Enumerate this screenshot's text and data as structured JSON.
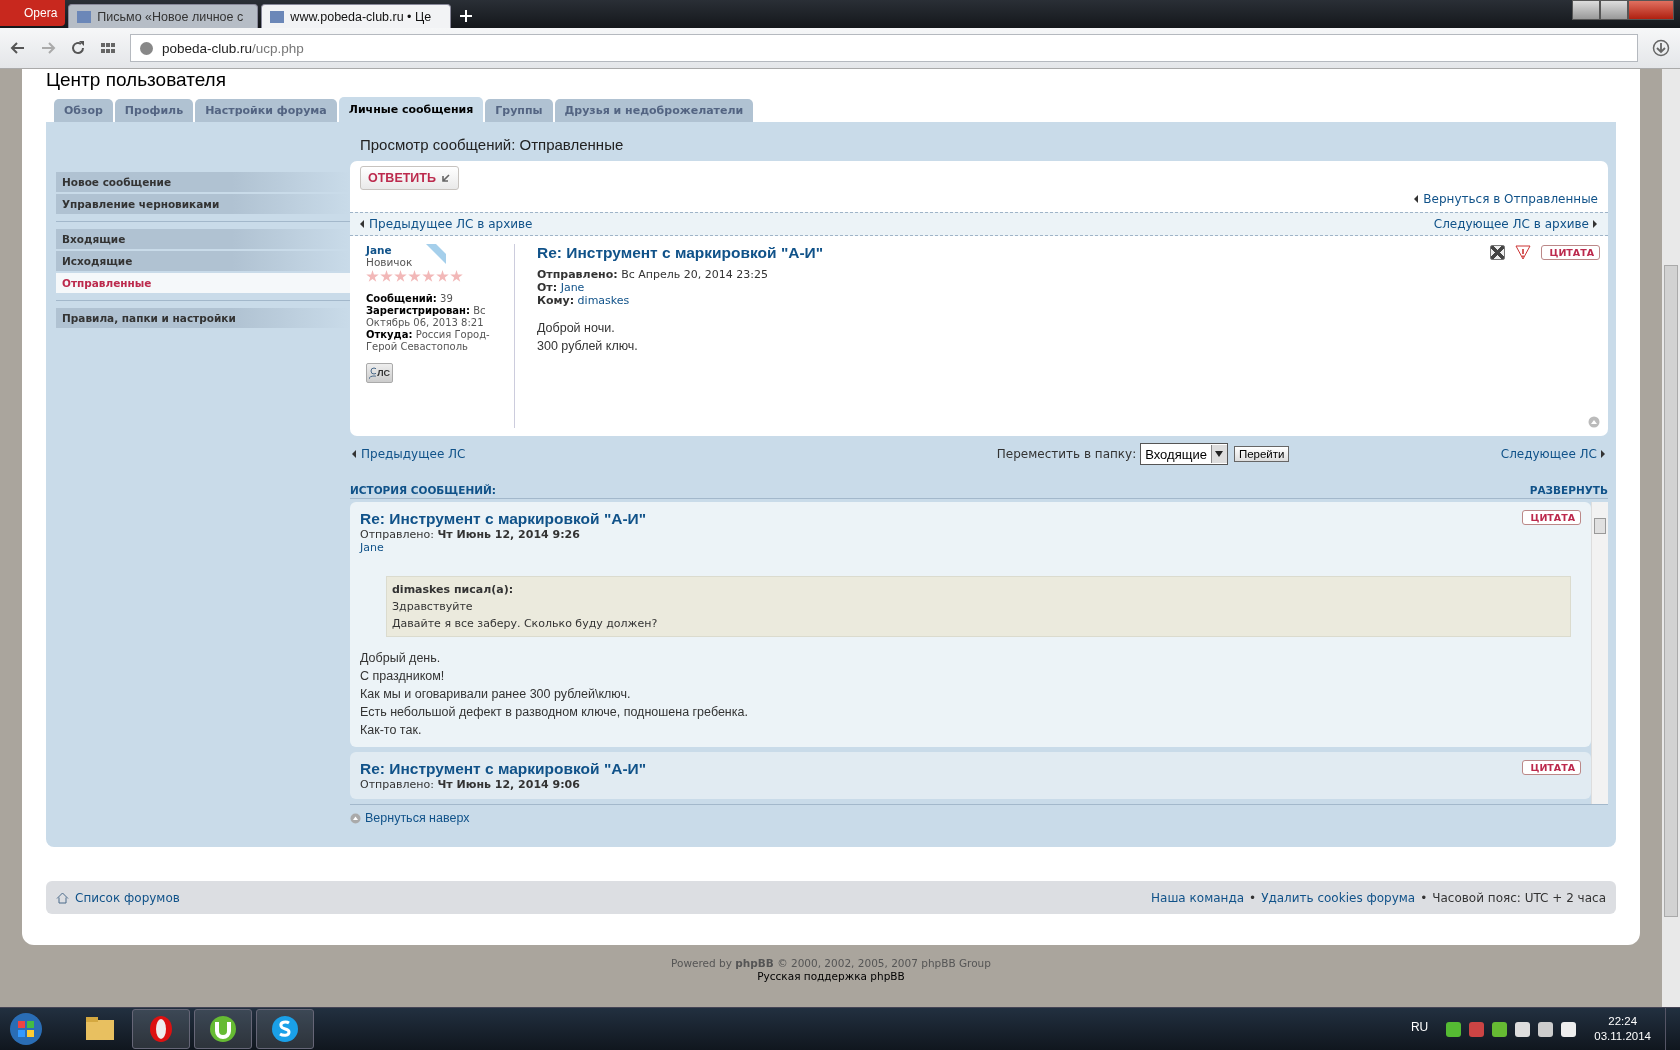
{
  "browser": {
    "menu": "Opera",
    "tabs": [
      {
        "label": "Письмо «Новое личное с",
        "selected": false
      },
      {
        "label": "www.pobeda-club.ru • Це",
        "selected": true
      }
    ],
    "address": {
      "host": "pobeda-club.ru",
      "path": "/ucp.php"
    }
  },
  "heading": "Центр пользователя",
  "tabs": [
    {
      "label": "Обзор",
      "selected": false
    },
    {
      "label": "Профиль",
      "selected": false
    },
    {
      "label": "Настройки форума",
      "selected": false
    },
    {
      "label": "Личные сообщения",
      "selected": true
    },
    {
      "label": "Группы",
      "selected": false
    },
    {
      "label": "Друзья и недоброжелатели",
      "selected": false
    }
  ],
  "sidebar": [
    [
      {
        "label": "Новое сообщение",
        "selected": false
      },
      {
        "label": "Управление черновиками",
        "selected": false
      }
    ],
    [
      {
        "label": "Входящие",
        "selected": false
      },
      {
        "label": "Исходящие",
        "selected": false
      },
      {
        "label": "Отправленные",
        "selected": true
      }
    ],
    [
      {
        "label": "Правила, папки и настройки",
        "selected": false
      }
    ]
  ],
  "view_title": "Просмотр сообщений: Отправленные",
  "reply_button": "ОТВЕТИТЬ",
  "back_link": "Вернуться в Отправленные",
  "prev_archive": "Предыдущее ЛС в архиве",
  "next_archive": "Следующее ЛС в архиве",
  "message": {
    "author": "Jane",
    "rank": "Новичок",
    "stars": 7,
    "profile": [
      {
        "label": "Сообщений:",
        "value": "39"
      },
      {
        "label": "Зарегистрирован:",
        "value": "Вс Октябрь 06, 2013 8:21"
      },
      {
        "label": "Откуда:",
        "value": "Россия Город-Герой Севастополь"
      }
    ],
    "pm_button": "ЛС",
    "title": "Re: Инструмент с маркировкой \"А-И\"",
    "meta": [
      {
        "label": "Отправлено:",
        "value": "Вс Апрель 20, 2014 23:25",
        "link": false
      },
      {
        "label": "От:",
        "value": "Jane",
        "link": true
      },
      {
        "label": "Кому:",
        "value": "dimaskes",
        "link": true
      }
    ],
    "body": [
      "Доброй ночи.",
      "300 рублей ключ."
    ],
    "quote_button": "ЦИТАТА"
  },
  "nav": {
    "prev": "Предыдущее ЛС",
    "move_label": "Переместить в папку:",
    "folder": "Входящие",
    "go": "Перейти",
    "next": "Следующее ЛС"
  },
  "history": {
    "title": "ИСТОРИЯ СООБЩЕНИЙ:",
    "expand": "РАЗВЕРНУТЬ",
    "posts": [
      {
        "title": "Re: Инструмент с маркировкой \"А-И\"",
        "sent_label": "Отправлено:",
        "date": "Чт Июнь 12, 2014 9:26",
        "author": "Jane",
        "quote": {
          "author": "dimaskes писал(а):",
          "lines": [
            "Здравствуйте",
            "Давайте я все заберу. Сколько буду должен?"
          ]
        },
        "body": [
          "Добрый день.",
          "С праздником!",
          "Как мы и оговаривали ранее 300 рублей\\ключ.",
          "Есть небольшой дефект в разводном ключе, подношена гребенка.",
          "Как-то так."
        ],
        "quote_button": "ЦИТАТА"
      },
      {
        "title": "Re: Инструмент с маркировкой \"А-И\"",
        "sent_label": "Отправлено:",
        "date": "Чт Июнь 12, 2014 9:06",
        "quote_button": "ЦИТАТА"
      }
    ]
  },
  "back_top": "Вернуться наверх",
  "footer": {
    "home": "Список форумов",
    "links": [
      "Наша команда",
      "Удалить cookies форума"
    ],
    "separator": "•",
    "timezone": "Часовой пояс: UTC + 2 часа",
    "powered": "Powered by **phpBB** © 2000, 2002, 2005, 2007 phpBB Group",
    "support": "Русская поддержка phpBB"
  },
  "taskbar": {
    "lang": "RU",
    "time": "22:24",
    "date": "03.11.2014"
  }
}
